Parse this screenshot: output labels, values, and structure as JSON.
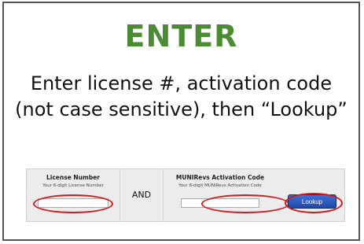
{
  "heading": "ENTER",
  "instructions": {
    "line1": "Enter license #, activation code",
    "line2": "(not case sensitive), then “Lookup”"
  },
  "form": {
    "license": {
      "title": "License Number",
      "subtitle": "Your 6-digit License Number",
      "value": ""
    },
    "and_label": "AND",
    "activation": {
      "title": "MUNIRevs Activation Code",
      "subtitle": "Your 6-digit MUNIRevs Activation Code",
      "value": ""
    },
    "lookup_label": "Lookup"
  },
  "colors": {
    "heading": "#4b8b32",
    "highlight_ring": "#d11a1a",
    "button": "#2a56c0"
  }
}
